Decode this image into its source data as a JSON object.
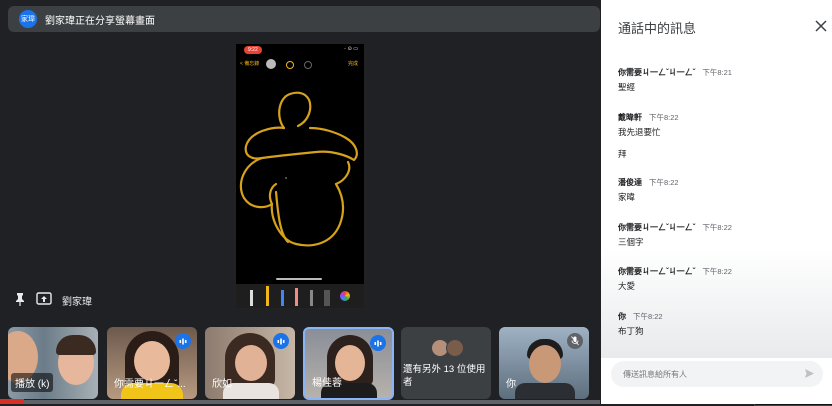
{
  "share_banner": {
    "avatar_text": "家瑋",
    "text": "劉家瑋正在分享螢幕畫面"
  },
  "phone": {
    "time": "9:22",
    "signal": "∙∙ ⊙ ▭",
    "back_label": "< 備忘錄",
    "done_label": "完成"
  },
  "presenter": {
    "name": "劉家瑋"
  },
  "tiles": [
    {
      "name": "播放 (k)"
    },
    {
      "name": "你需要ㄐ一ㄥˇ..."
    },
    {
      "name": "欣如"
    },
    {
      "name": "楊佳蓉"
    },
    {
      "name": "還有另外 13 位使用者"
    },
    {
      "name": "你"
    }
  ],
  "chat": {
    "title": "通話中的訊息",
    "messages": [
      {
        "sender": "你需要ㄐ一ㄥˇㄐ一ㄥˇ",
        "time": "下午8:21",
        "lines": [
          "聖經"
        ]
      },
      {
        "sender": "戴暐軒",
        "time": "下午8:22",
        "lines": [
          "我先退要忙",
          "拜"
        ]
      },
      {
        "sender": "潘俊達",
        "time": "下午8:22",
        "lines": [
          "家暐"
        ]
      },
      {
        "sender": "你需要ㄐ一ㄥˇㄐ一ㄥˇ",
        "time": "下午8:22",
        "lines": [
          "三個字"
        ]
      },
      {
        "sender": "你需要ㄐ一ㄥˇㄐ一ㄥˇ",
        "time": "下午8:22",
        "lines": [
          "大愛"
        ]
      },
      {
        "sender": "你",
        "time": "下午8:22",
        "lines": [
          "布丁狗"
        ]
      }
    ],
    "input_placeholder": "傳送訊息給所有人"
  },
  "colors": {
    "accent": "#1a73e8",
    "drawing": "#d6a21c",
    "background": "#202124"
  }
}
